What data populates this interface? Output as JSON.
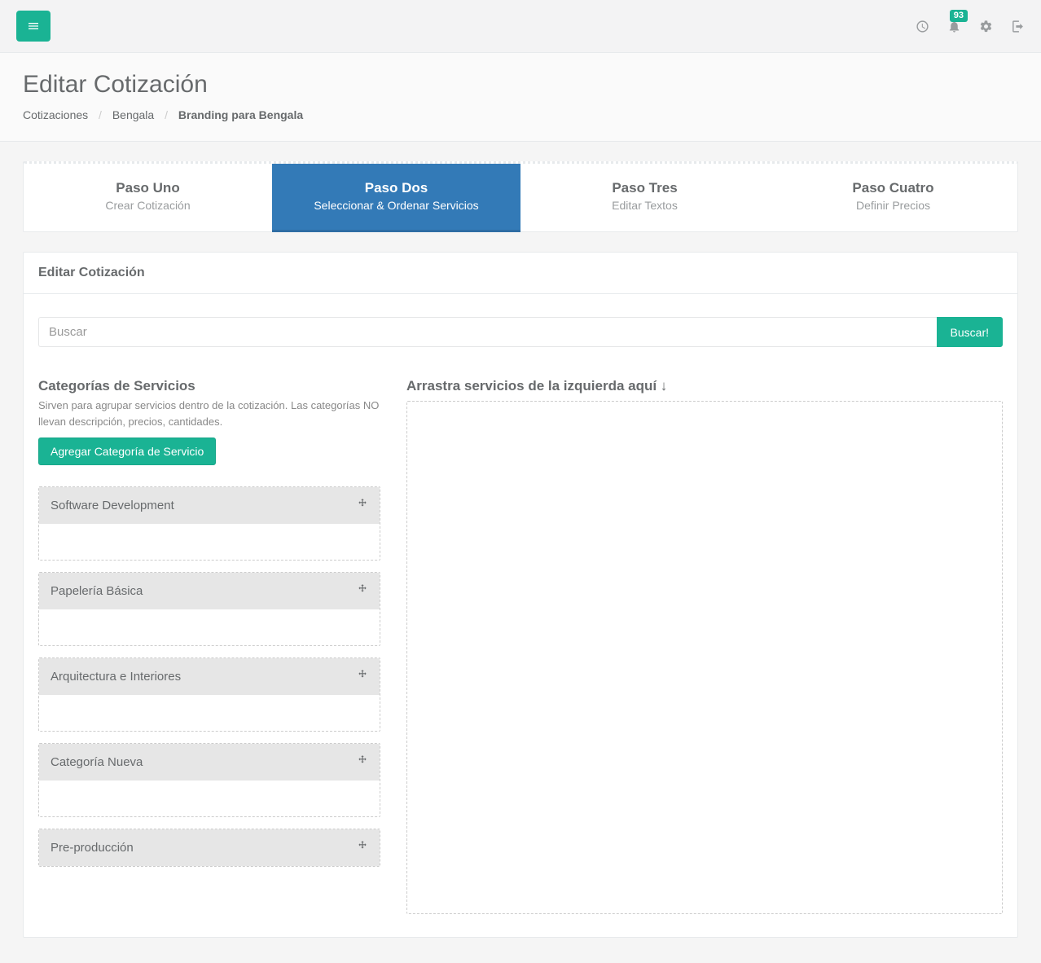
{
  "topbar": {
    "notification_count": "93"
  },
  "header": {
    "title": "Editar Cotización",
    "breadcrumb": [
      "Cotizaciones",
      "Bengala"
    ],
    "breadcrumb_current": "Branding para Bengala"
  },
  "steps": [
    {
      "title": "Paso Uno",
      "sub": "Crear Cotización",
      "active": false
    },
    {
      "title": "Paso Dos",
      "sub": "Seleccionar & Ordenar Servicios",
      "active": true
    },
    {
      "title": "Paso Tres",
      "sub": "Editar Textos",
      "active": false
    },
    {
      "title": "Paso Cuatro",
      "sub": "Definir Precios",
      "active": false
    }
  ],
  "panel": {
    "title": "Editar Cotización",
    "search_placeholder": "Buscar",
    "search_button": "Buscar!"
  },
  "left": {
    "title": "Categorías de Servicios",
    "desc": "Sirven para agrupar servicios dentro de la cotización. Las categorías NO llevan descripción, precios, cantidades.",
    "add_button": "Agregar Categoría de Servicio",
    "categories": [
      "Software Development",
      "Papelería Básica",
      "Arquitectura e Interiores",
      "Categoría Nueva",
      "Pre-producción"
    ]
  },
  "right": {
    "title": "Arrastra servicios de la izquierda aquí ↓"
  }
}
